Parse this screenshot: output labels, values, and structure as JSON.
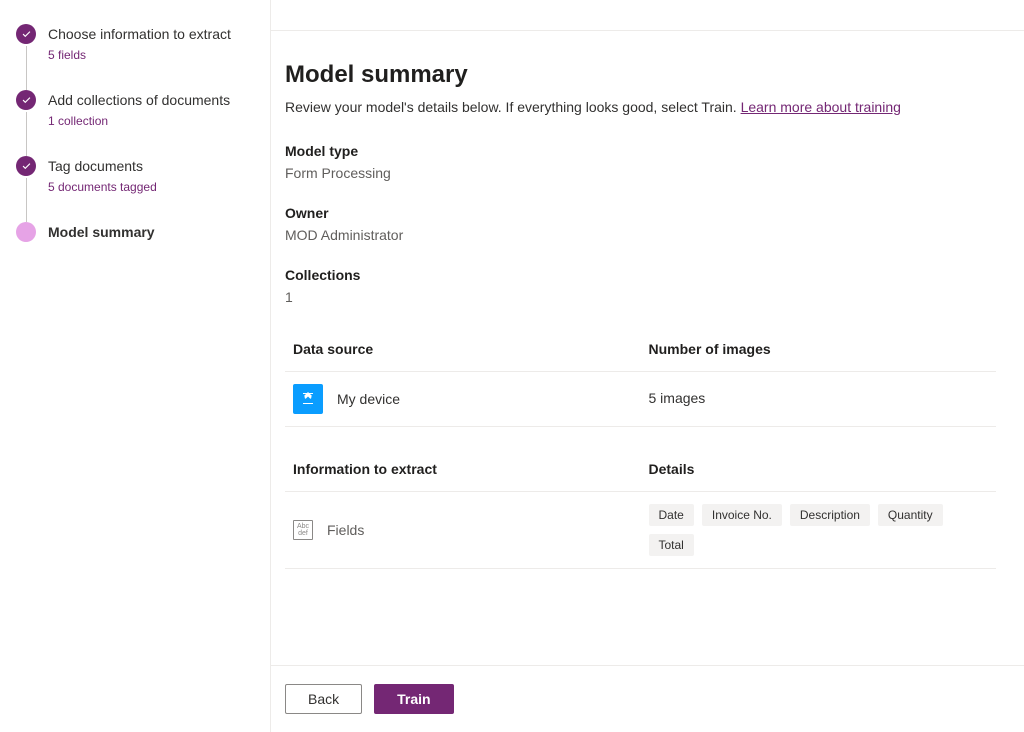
{
  "stepper": {
    "items": [
      {
        "title": "Choose information to extract",
        "sub": "5 fields",
        "state": "done"
      },
      {
        "title": "Add collections of documents",
        "sub": "1 collection",
        "state": "done"
      },
      {
        "title": "Tag documents",
        "sub": "5 documents tagged",
        "state": "done"
      },
      {
        "title": "Model summary",
        "sub": "",
        "state": "active"
      }
    ]
  },
  "summary": {
    "title": "Model summary",
    "description_pre": "Review your model's details below. If everything looks good, select Train. ",
    "learn_link": "Learn more about training",
    "model_type_label": "Model type",
    "model_type_value": "Form Processing",
    "owner_label": "Owner",
    "owner_value": "MOD Administrator",
    "collections_label": "Collections",
    "collections_value": "1"
  },
  "data_source_table": {
    "col1": "Data source",
    "col2": "Number of images",
    "source_name": "My device",
    "image_count": "5 images"
  },
  "extract_table": {
    "col1": "Information to extract",
    "col2": "Details",
    "row_label": "Fields",
    "tags": [
      "Date",
      "Invoice No.",
      "Description",
      "Quantity",
      "Total"
    ]
  },
  "footer": {
    "back": "Back",
    "train": "Train"
  }
}
